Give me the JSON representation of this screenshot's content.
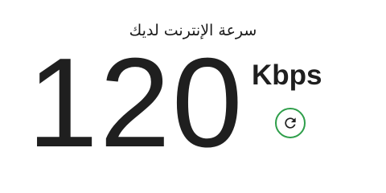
{
  "speed_test": {
    "title": "سرعة الإنترنت لديك",
    "speed_value": "120",
    "speed_unit": "Kbps",
    "refresh_icon": "refresh-icon",
    "colors": {
      "accent": "#2e9e4a",
      "text": "#1f1f1f"
    }
  }
}
